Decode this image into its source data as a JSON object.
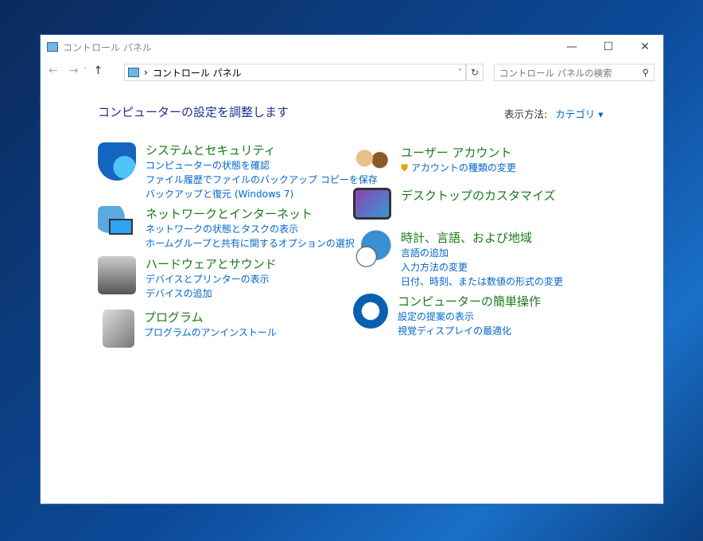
{
  "window": {
    "title": "コントロール パネル",
    "min": "—",
    "max": "☐",
    "close": "✕"
  },
  "nav": {
    "back": "←",
    "forward": "→",
    "recent": "˅",
    "up": "↑",
    "sep": "›",
    "address": "コントロール パネル",
    "dropdown": "˅",
    "refresh": "↻",
    "search_placeholder": "コントロール パネルの検索",
    "search_icon": "⚲"
  },
  "main": {
    "heading": "コンピューターの設定を調整します",
    "viewby_label": "表示方法:",
    "viewby_value": "カテゴリ ▾"
  },
  "left": [
    {
      "title": "システムとセキュリティ",
      "links": [
        "コンピューターの状態を確認",
        "ファイル履歴でファイルのバックアップ コピーを保存",
        "バックアップと復元 (Windows 7)"
      ]
    },
    {
      "title": "ネットワークとインターネット",
      "links": [
        "ネットワークの状態とタスクの表示",
        "ホームグループと共有に関するオプションの選択"
      ]
    },
    {
      "title": "ハードウェアとサウンド",
      "links": [
        "デバイスとプリンターの表示",
        "デバイスの追加"
      ]
    },
    {
      "title": "プログラム",
      "links": [
        "プログラムのアンインストール"
      ]
    }
  ],
  "right": [
    {
      "title": "ユーザー アカウント",
      "links": [
        "アカウントの種類の変更"
      ]
    },
    {
      "title": "デスクトップのカスタマイズ",
      "links": []
    },
    {
      "title": "時計、言語、および地域",
      "links": [
        "言語の追加",
        "入力方法の変更",
        "日付、時刻、または数値の形式の変更"
      ]
    },
    {
      "title": "コンピューターの簡単操作",
      "links": [
        "設定の提案の表示",
        "視覚ディスプレイの最適化"
      ]
    }
  ]
}
